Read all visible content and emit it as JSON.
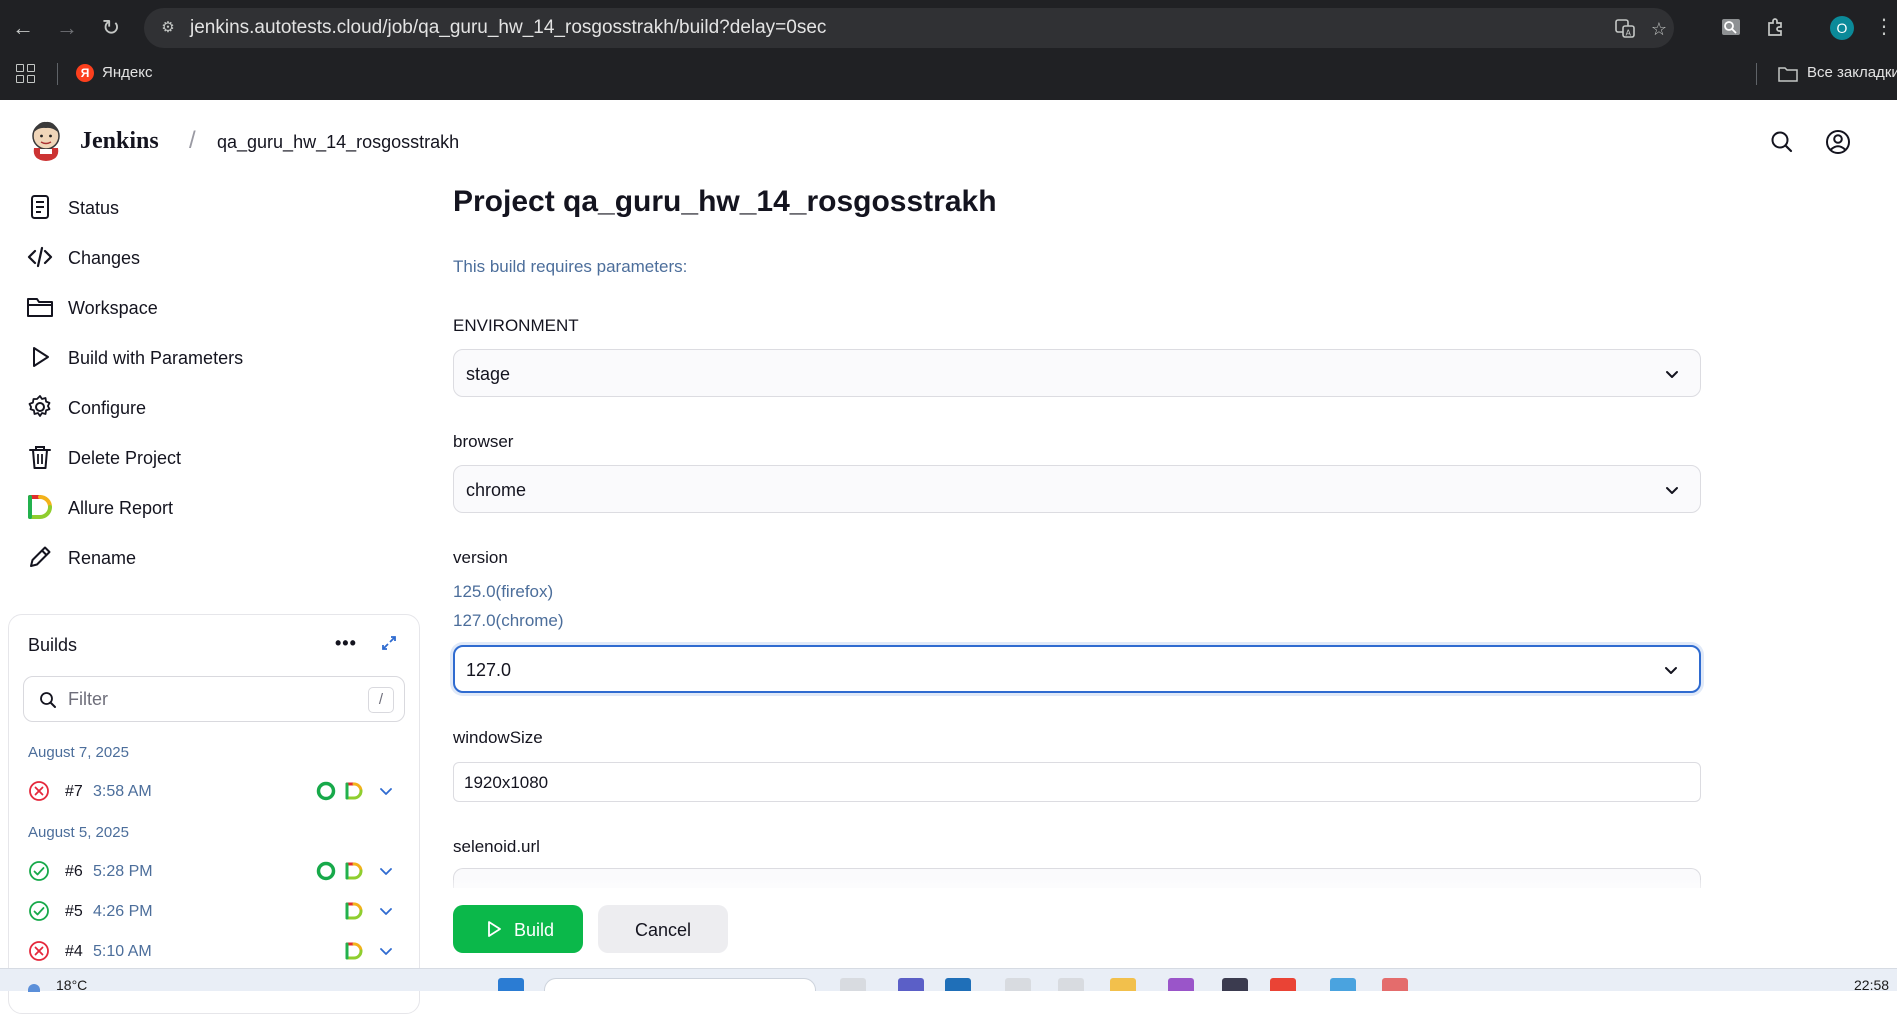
{
  "browser": {
    "url": "jenkins.autotests.cloud/job/qa_guru_hw_14_rosgosstrakh/build?delay=0sec",
    "profile_initial": "O",
    "bookmarks": [
      {
        "label": "Яндекс",
        "icon": "yandex-icon"
      }
    ],
    "all_bookmarks_label": "Все закладки"
  },
  "header": {
    "brand": "Jenkins",
    "separator": "/",
    "breadcrumb": "qa_guru_hw_14_rosgosstrakh"
  },
  "sidebar": {
    "items": [
      {
        "label": "Status",
        "icon": "status-document-icon"
      },
      {
        "label": "Changes",
        "icon": "code-icon"
      },
      {
        "label": "Workspace",
        "icon": "folder-icon"
      },
      {
        "label": "Build with Parameters",
        "icon": "play-icon"
      },
      {
        "label": "Configure",
        "icon": "gear-icon"
      },
      {
        "label": "Delete Project",
        "icon": "trash-icon"
      },
      {
        "label": "Allure Report",
        "icon": "allure-icon"
      },
      {
        "label": "Rename",
        "icon": "pencil-icon"
      }
    ]
  },
  "builds": {
    "title": "Builds",
    "more": "•••",
    "filter_placeholder": "Filter",
    "filter_shortcut": "/",
    "groups": [
      {
        "date": "August 7, 2025",
        "rows": [
          {
            "number": "#7",
            "time": "3:58 AM",
            "status": "failed"
          }
        ]
      },
      {
        "date": "August 5, 2025",
        "rows": [
          {
            "number": "#6",
            "time": "5:28 PM",
            "status": "success"
          },
          {
            "number": "#5",
            "time": "4:26 PM",
            "status": "success"
          },
          {
            "number": "#4",
            "time": "5:10 AM",
            "status": "failed"
          }
        ]
      }
    ]
  },
  "main": {
    "title": "Project qa_guru_hw_14_rosgosstrakh",
    "subtitle": "This build requires parameters:",
    "params": {
      "environment": {
        "label": "ENVIRONMENT",
        "value": "stage"
      },
      "browser": {
        "label": "browser",
        "value": "chrome"
      },
      "version": {
        "label": "version",
        "descriptions": [
          "125.0(firefox)",
          "127.0(chrome)"
        ],
        "value": "127.0"
      },
      "window_size": {
        "label": "windowSize",
        "value": "1920x1080"
      },
      "selenoid_url": {
        "label": "selenoid.url"
      }
    },
    "build_label": "Build",
    "cancel_label": "Cancel"
  },
  "taskbar": {
    "weather": "18°C",
    "time": "22:58"
  },
  "colors": {
    "accent_green": "#0bb84a",
    "link_blue": "#4c6e9b",
    "focus_blue": "#2f6bd0",
    "failure_red": "#e5283c",
    "success_green": "#17a94a"
  }
}
